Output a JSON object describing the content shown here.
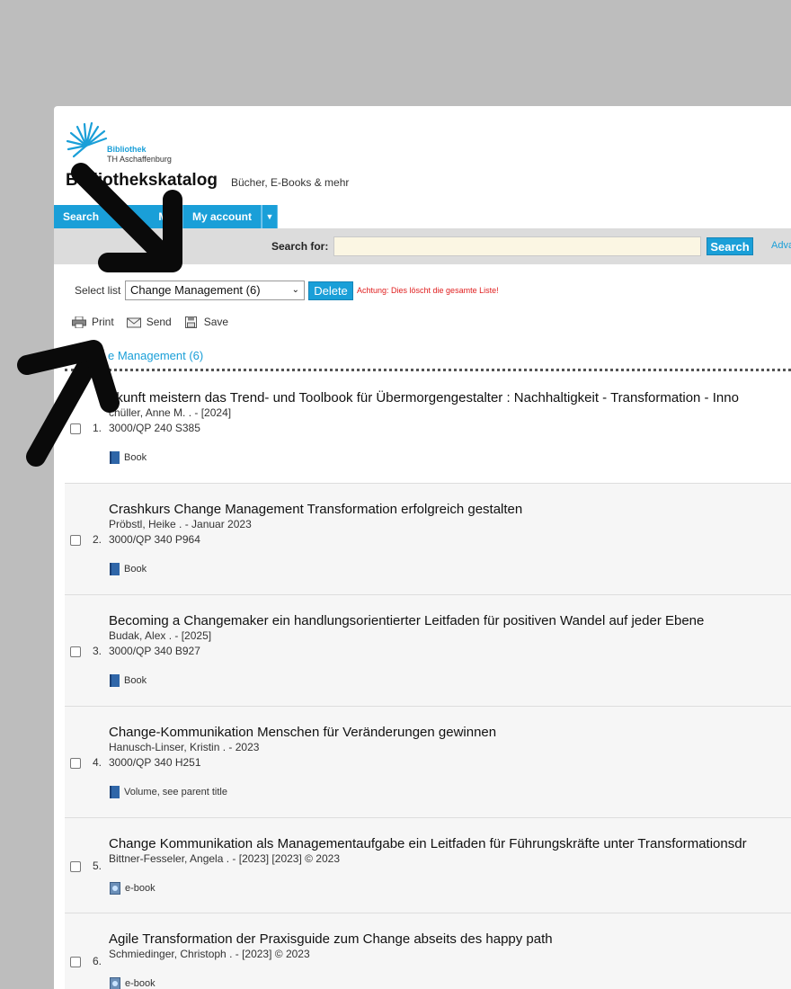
{
  "header": {
    "logo_line1": "Bibliothek",
    "logo_line2": "TH Aschaffenburg",
    "title": "Bibliothekskatalog",
    "subtitle": "Bücher, E-Books & mehr"
  },
  "tabs": [
    {
      "label": "Search"
    },
    {
      "label": "My"
    },
    {
      "label": "My account"
    }
  ],
  "search": {
    "label": "Search for:",
    "value": "",
    "button": "Search",
    "advanced_link": "Adva"
  },
  "list_controls": {
    "select_label": "Select list",
    "selected": "Change Management (6)",
    "delete_button": "Delete",
    "warning": "Achtung: Dies löscht die gesamte Liste!"
  },
  "actions": {
    "print": "Print",
    "send": "Send",
    "save": "Save"
  },
  "list_heading": "e Management (6)",
  "results": [
    {
      "num": "1.",
      "title": "ukunft meistern das Trend- und Toolbook für Übermorgengestalter : Nachhaltigkeit - Transformation - Inno",
      "author": "chüller, Anne M. . - [2024]",
      "call": "3000/QP 240 S385",
      "type": "Book",
      "icon": "book-icon"
    },
    {
      "num": "2.",
      "title": "Crashkurs Change Management Transformation erfolgreich gestalten",
      "author": "Pröbstl, Heike . - Januar 2023",
      "call": "3000/QP 340 P964",
      "type": "Book",
      "icon": "book-icon"
    },
    {
      "num": "3.",
      "title": "Becoming a Changemaker ein handlungsorientierter Leitfaden für positiven Wandel auf jeder Ebene",
      "author": "Budak, Alex . - [2025]",
      "call": "3000/QP 340 B927",
      "type": "Book",
      "icon": "book-icon"
    },
    {
      "num": "4.",
      "title": "Change-Kommunikation Menschen für Veränderungen gewinnen",
      "author": "Hanusch-Linser, Kristin . - 2023",
      "call": "3000/QP 340 H251",
      "type": "Volume, see parent title",
      "icon": "book-icon"
    },
    {
      "num": "5.",
      "title": "Change Kommunikation als Managementaufgabe ein Leitfaden für Führungskräfte unter Transformationsdr",
      "author": "Bittner-Fesseler, Angela . - [2023] [2023] © 2023",
      "call": "",
      "type": "e-book",
      "icon": "ebook-icon"
    },
    {
      "num": "6.",
      "title": "Agile Transformation der Praxisguide zum Change abseits des happy path",
      "author": "Schmiedinger, Christoph . - [2023] © 2023",
      "call": "",
      "type": "e-book",
      "icon": "ebook-icon"
    }
  ]
}
